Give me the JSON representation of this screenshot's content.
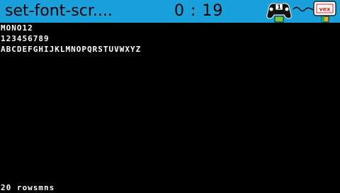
{
  "header": {
    "program_title": "set-font-scr....",
    "timer": "0 : 19",
    "controller_badge": "1",
    "brain_label": "vex"
  },
  "colors": {
    "header_bg": "#1aa0db",
    "screen_bg": "#000000",
    "text": "#ffffff",
    "battery_fill": "#7cc43a"
  },
  "icons": {
    "controller": "gamepad-icon",
    "link": "radio-link-icon",
    "brain": "vex-brain-icon"
  },
  "screen": {
    "lines": [
      "MONO12",
      "123456789",
      "ABCDEFGHIJKLMNOPQRSTUVWXYZ"
    ],
    "footer": "20 rowsmns"
  }
}
